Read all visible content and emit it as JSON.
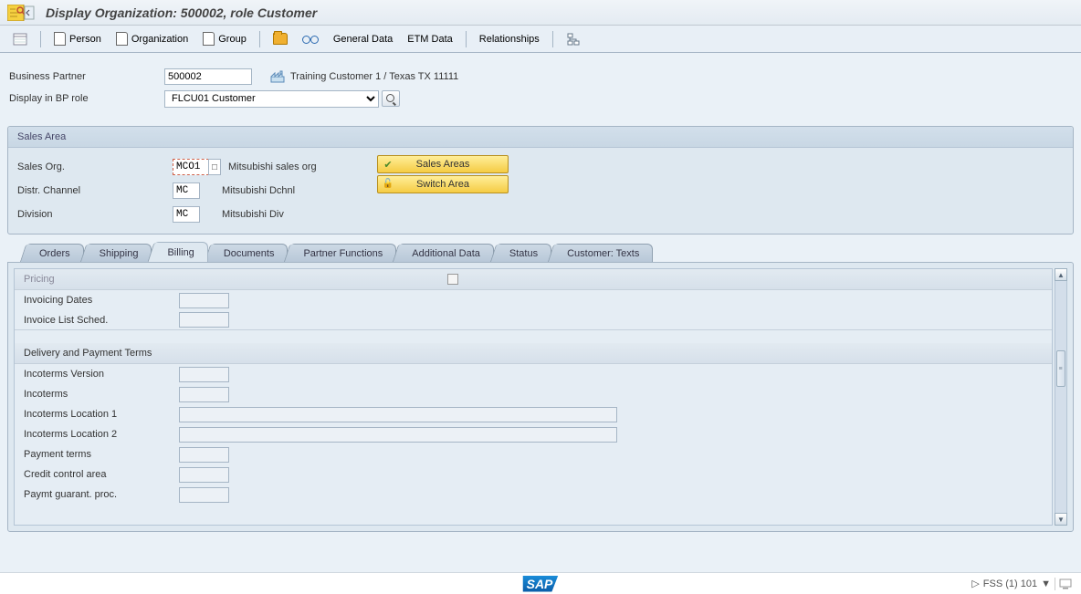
{
  "title": "Display Organization: 500002, role Customer",
  "toolbar": {
    "person": "Person",
    "organization": "Organization",
    "group": "Group",
    "general_data": "General Data",
    "etm_data": "ETM Data",
    "relationships": "Relationships"
  },
  "header": {
    "bp_label": "Business Partner",
    "bp_value": "500002",
    "bp_descr": "Training Customer 1 / Texas TX 11111",
    "role_label": "Display in BP role",
    "role_value": "FLCU01 Customer"
  },
  "sales_area": {
    "title": "Sales Area",
    "sales_org_label": "Sales Org.",
    "sales_org_value": "MCO1",
    "sales_org_descr": "Mitsubishi sales org",
    "distr_channel_label": "Distr. Channel",
    "distr_channel_value": "MC",
    "distr_channel_descr": "Mitsubishi Dchnl",
    "division_label": "Division",
    "division_value": "MC",
    "division_descr": "Mitsubishi Div",
    "btn_sales_areas": "Sales Areas",
    "btn_switch_area": "Switch Area"
  },
  "tabs": [
    "Orders",
    "Shipping",
    "Billing",
    "Documents",
    "Partner Functions",
    "Additional Data",
    "Status",
    "Customer: Texts"
  ],
  "active_tab": "Billing",
  "billing": {
    "pricing_section": "Pricing",
    "invoicing_dates": "Invoicing Dates",
    "invoice_list_sched": "Invoice List Sched.",
    "delivery_section": "Delivery and Payment Terms",
    "incoterms_version": "Incoterms Version",
    "incoterms": "Incoterms",
    "incoterms_loc1": "Incoterms Location 1",
    "incoterms_loc2": "Incoterms Location 2",
    "payment_terms": "Payment terms",
    "credit_control": "Credit control area",
    "paymt_guarant": "Paymt guarant. proc."
  },
  "status": {
    "system": "FSS (1) 101"
  }
}
